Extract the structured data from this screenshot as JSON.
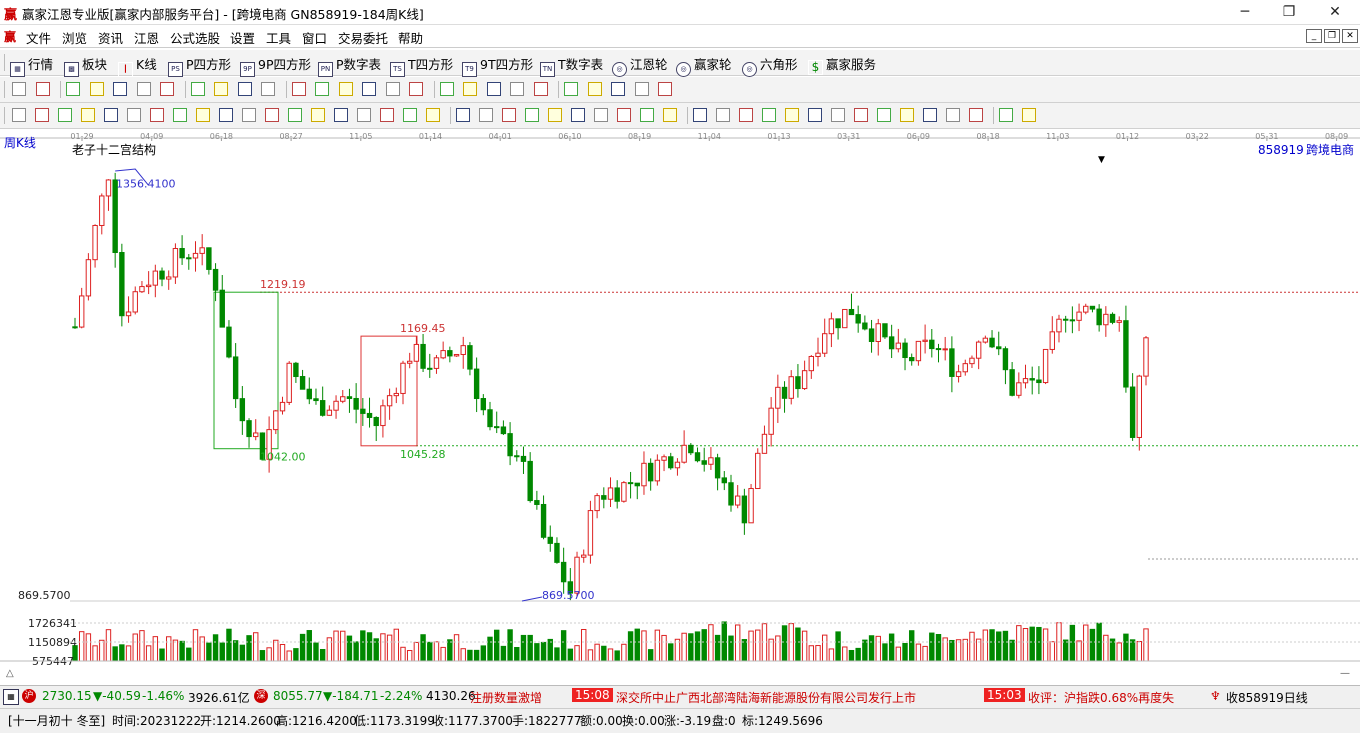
{
  "window": {
    "logo_char": "赢",
    "title": "赢家江恩专业版[赢家内部服务平台] - [跨境电商  GN858919-184周K线]",
    "btn_min": "─",
    "btn_max": "❐",
    "btn_close": "✕"
  },
  "menu": {
    "logo_char": "赢",
    "items": [
      "文件",
      "浏览",
      "资讯",
      "江恩",
      "公式选股",
      "设置",
      "工具",
      "窗口",
      "交易委托",
      "帮助"
    ],
    "mdi": [
      "_",
      "❐",
      "✕"
    ]
  },
  "toolbar1": {
    "items": [
      {
        "icon": "grid-icon",
        "label": "行情"
      },
      {
        "icon": "block-icon",
        "label": "板块"
      },
      {
        "icon": "kline-icon",
        "label": "K线"
      },
      {
        "icon": "ps-icon",
        "badge": "PS",
        "label": "P四方形"
      },
      {
        "icon": "9p-icon",
        "badge": "9P",
        "label": "9P四方形"
      },
      {
        "icon": "pn-icon",
        "badge": "PN",
        "label": "P数字表"
      },
      {
        "icon": "ts-icon",
        "badge": "TS",
        "label": "T四方形"
      },
      {
        "icon": "t9-icon",
        "badge": "T9",
        "label": "9T四方形"
      },
      {
        "icon": "tn-icon",
        "badge": "TN",
        "label": "T数字表"
      },
      {
        "icon": "gann-wheel-icon",
        "badge": "◎",
        "label": "江恩轮"
      },
      {
        "icon": "winner-wheel-icon",
        "badge": "◎",
        "label": "赢家轮"
      },
      {
        "icon": "hexagon-icon",
        "badge": "◎",
        "label": "六角形"
      },
      {
        "icon": "dollar-icon",
        "badge": "$",
        "label": "赢家服务"
      }
    ]
  },
  "chart_header": {
    "period_label": "周K线",
    "indicator_label": "老子十二宫结构",
    "symbol_code": "858919",
    "symbol_name": "跨境电商"
  },
  "chart_data": {
    "type": "candlestick",
    "period": "weekly",
    "x_tick_labels": [
      "01-29",
      "04-09",
      "06-18",
      "08-27",
      "11-05",
      "01-14",
      "04-01",
      "06-10",
      "08-19",
      "11-04",
      "01-13",
      "03-31",
      "06-09",
      "08-18",
      "11-03",
      "01-12",
      "03-22",
      "05-31",
      "08-09"
    ],
    "y_range": [
      869.57,
      1356.41
    ],
    "annotations": {
      "high_label": "1356.4100",
      "low_label": "869.5700",
      "left_axis_low": "869.5700",
      "level_1219": "1219.19",
      "level_1169": "1169.45",
      "level_1042": "1042.00",
      "level_1045": "1045.28"
    },
    "volume_axis_labels": [
      "1726341",
      "1150894",
      "575447"
    ],
    "last_bar": {
      "date": "20231222",
      "open": 1214.26,
      "high": 1216.42,
      "low": 1173.3199,
      "close": 1177.37
    }
  },
  "status": {
    "sh_index": "2730.15",
    "sh_change": "▼-40.59",
    "sh_pct": "-1.46%",
    "sh_amount": "3926.61亿",
    "sz_index": "8055.77",
    "sz_change": "▼-184.71",
    "sz_pct": "-2.24%",
    "sz_amount": "4130.26",
    "news1": "注册数量激增",
    "time1": "15:08",
    "news2": "深交所中止广西北部湾陆海新能源股份有限公司发行上市",
    "time2": "15:03",
    "news3": "收评：沪指跌0.68%再度失",
    "right_label": "收858919日线"
  },
  "info": {
    "lunar": "[十一月初十 冬至]",
    "time": "时间:20231222",
    "open": "开:1214.2600",
    "high": "高:1216.4200",
    "low": "低:1173.3199",
    "close": "收:1177.3700",
    "hands": "手:1822777",
    "amount": "额:0.00",
    "turnover": "换:0.00",
    "change": "涨:-3.19",
    "pan": "盘:0",
    "mark": "标:1249.5696"
  }
}
